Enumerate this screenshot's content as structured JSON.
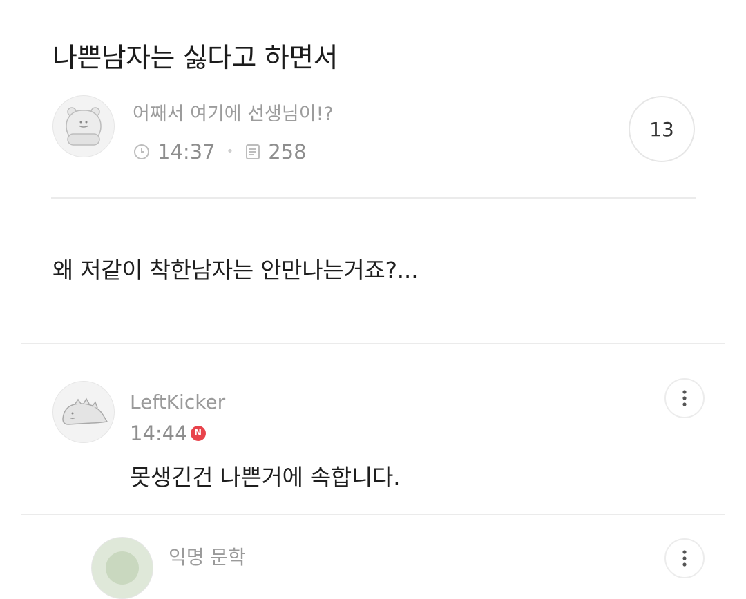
{
  "post": {
    "title": "나쁜남자는 싫다고 하면서",
    "author": "어째서 여기에 선생님이!?",
    "time": "14:37",
    "views": "258",
    "comment_count": "13",
    "body": "왜 저같이 착한남자는 안만나는거죠?..."
  },
  "comments": [
    {
      "author": "LeftKicker",
      "time": "14:44",
      "badge": "N",
      "text": "못생긴건 나쁜거에 속합니다."
    },
    {
      "author": "익명 문학"
    }
  ],
  "colors": {
    "badge": "#e8434b",
    "muted_text": "#9a9a9a",
    "divider": "#ebebeb"
  },
  "icons": {
    "time": "clock-icon",
    "views": "document-icon",
    "more": "more-vertical-icon"
  }
}
